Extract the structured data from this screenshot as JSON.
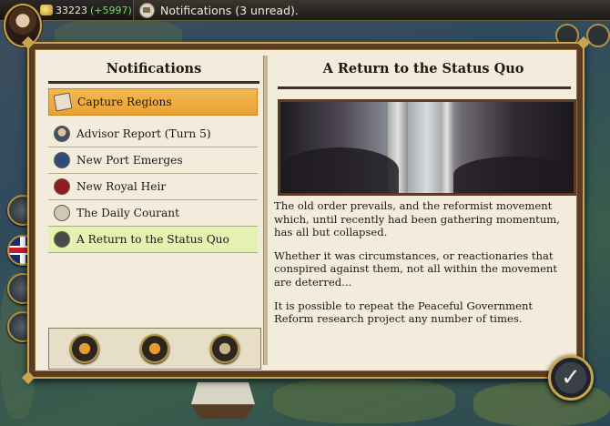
{
  "topbar": {
    "treasury": "33223",
    "treasury_delta": "(+5997)",
    "notification_text": "Notifications (3 unread)."
  },
  "left_panel": {
    "title": "Notifications",
    "items": [
      {
        "label": "Capture Regions",
        "icon": "scroll-icon",
        "state": "selected"
      },
      {
        "label": "Advisor Report (Turn 5)",
        "icon": "advisor-icon",
        "state": "normal"
      },
      {
        "label": "New Port Emerges",
        "icon": "anchor-icon",
        "state": "normal"
      },
      {
        "label": "New Royal Heir",
        "icon": "heir-icon",
        "state": "normal"
      },
      {
        "label": "The Daily Courant",
        "icon": "newspaper-icon",
        "state": "normal"
      },
      {
        "label": "A Return to the Status Quo",
        "icon": "gear-icon",
        "state": "current"
      }
    ]
  },
  "right_panel": {
    "title": "A Return to the Status Quo",
    "paragraphs": [
      "The old order prevails, and the reformist movement which, until recently had been gathering momentum, has all but collapsed.",
      "Whether it was circumstances, or reactionaries that conspired against them, not all within the movement are deterred...",
      "It is possible to repeat the Peaceful Government Reform research project any number of times."
    ]
  },
  "colors": {
    "selected_row": "#f0b048",
    "current_row": "#e4f1b1",
    "panel_frame": "#5b3a22",
    "gold_trim": "#c9a451",
    "treasury_delta": "#6fdc6f"
  }
}
